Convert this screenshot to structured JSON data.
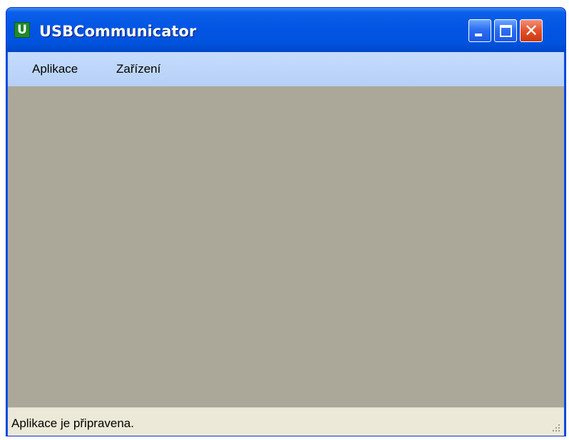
{
  "window": {
    "title": "USBCommunicator",
    "icon_letter": "U",
    "icon": "app-u-icon",
    "controls": {
      "minimize_icon": "minimize-icon",
      "maximize_icon": "maximize-icon",
      "close_icon": "close-icon",
      "close_glyph": "✕"
    }
  },
  "menubar": {
    "items": [
      {
        "label": "Aplikace"
      },
      {
        "label": "Zařízení"
      }
    ]
  },
  "statusbar": {
    "text": "Aplikace je připravena."
  },
  "colors": {
    "titlebar": "#0355e3",
    "menubar": "#c5dcfc",
    "workspace": "#aca899",
    "statusbar": "#ece9d8",
    "close_button": "#e2522c"
  }
}
